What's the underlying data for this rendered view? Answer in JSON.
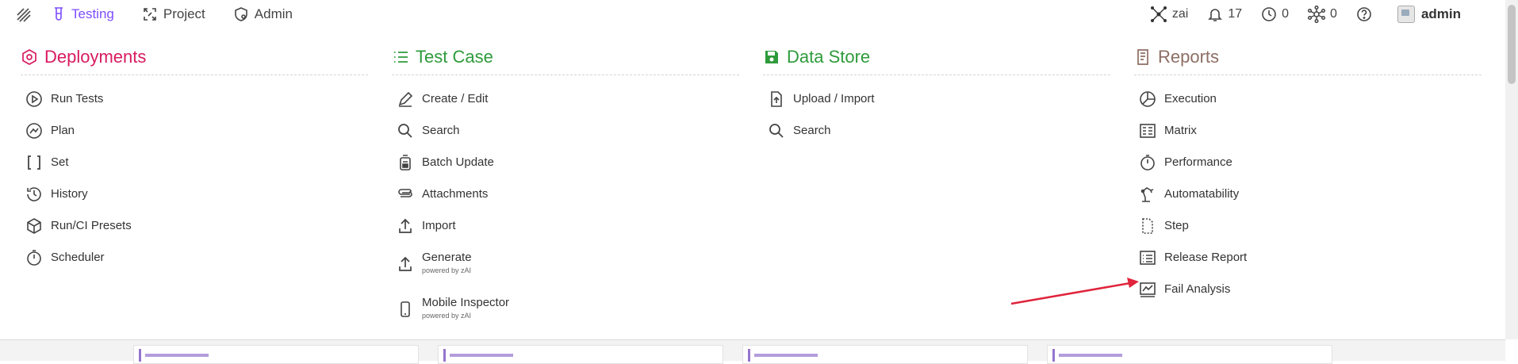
{
  "nav": {
    "items": [
      {
        "label": "Testing",
        "icon": "test-tube-icon",
        "active": true
      },
      {
        "label": "Project",
        "icon": "project-icon",
        "active": false
      },
      {
        "label": "Admin",
        "icon": "admin-icon",
        "active": false
      }
    ]
  },
  "tools": {
    "zai_label": "zai",
    "notifications_count": "17",
    "history_count": "0",
    "network_count": "0"
  },
  "user": {
    "name": "admin"
  },
  "columns": {
    "deployments": {
      "title": "Deployments",
      "items": [
        "Run Tests",
        "Plan",
        "Set",
        "History",
        "Run/CI Presets",
        "Scheduler"
      ]
    },
    "testcase": {
      "title": "Test Case",
      "items": [
        "Create / Edit",
        "Search",
        "Batch Update",
        "Attachments",
        "Import",
        "Generate",
        "Mobile Inspector"
      ],
      "powered": "powered by zAI"
    },
    "datastore": {
      "title": "Data Store",
      "items": [
        "Upload / Import",
        "Search"
      ]
    },
    "reports": {
      "title": "Reports",
      "items": [
        "Execution",
        "Matrix",
        "Performance",
        "Automatability",
        "Step",
        "Release Report",
        "Fail Analysis"
      ]
    }
  },
  "colors": {
    "accent": "#7c4dff",
    "deployments": "#d81b60",
    "testcase": "#2e9b3b",
    "datastore": "#2e9b3b",
    "reports": "#8d6e63",
    "annotation": "#e0243c"
  }
}
